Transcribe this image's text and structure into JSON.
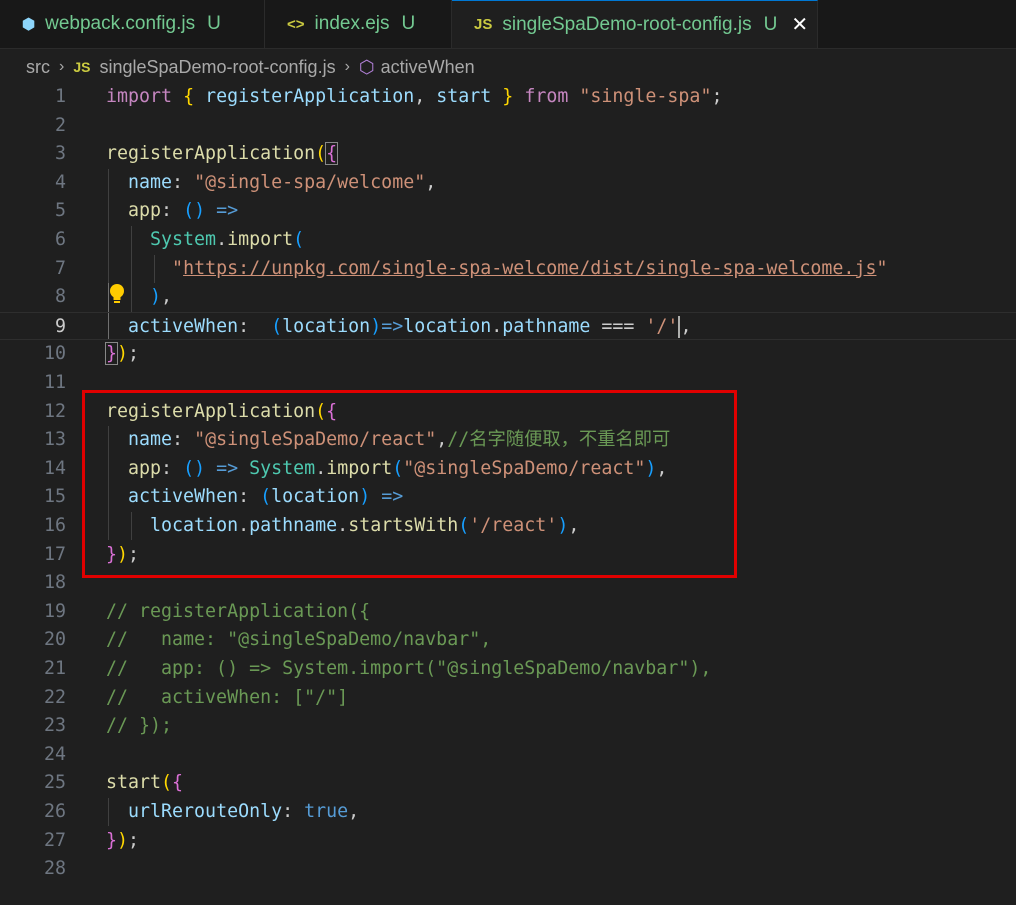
{
  "tabs": [
    {
      "icon": "webpack-icon",
      "name": "webpack.config.js",
      "status": "U"
    },
    {
      "icon": "ejs-file-icon",
      "name": "index.ejs",
      "status": "U"
    },
    {
      "icon": "js-file-icon",
      "prefix": "JS",
      "name": "singleSpaDemo-root-config.js",
      "status": "U",
      "close": "✕"
    }
  ],
  "breadcrumb": {
    "folder": "src",
    "file_prefix": "JS",
    "file": "singleSpaDemo-root-config.js",
    "symbol": "activeWhen"
  },
  "line_numbers": [
    "1",
    "2",
    "3",
    "4",
    "5",
    "6",
    "7",
    "8",
    "9",
    "10",
    "11",
    "12",
    "13",
    "14",
    "15",
    "16",
    "17",
    "18",
    "19",
    "20",
    "21",
    "22",
    "23",
    "24",
    "25",
    "26",
    "27",
    "28"
  ],
  "current_line": 9,
  "code": {
    "l1": {
      "import": "import",
      "ob": "{",
      "name1": "registerApplication",
      "comma": ",",
      "name2": "start",
      "cb": "}",
      "from": "from",
      "module": "\"single-spa\"",
      "semi": ";"
    },
    "l3": {
      "fn": "registerApplication",
      "p": "(",
      "b": "{"
    },
    "l4": {
      "key": "name",
      "colon": ":",
      "val": "\"@single-spa/welcome\"",
      "comma": ","
    },
    "l5": {
      "key": "app",
      "colon": ":",
      "paren": "()",
      "arrow": "=>"
    },
    "l6": {
      "obj": "System",
      "dot": ".",
      "fn": "import",
      "p": "("
    },
    "l7": {
      "q1": "\"",
      "url": "https://unpkg.com/single-spa-welcome/dist/single-spa-welcome.js",
      "q2": "\""
    },
    "l8": {
      "p": ")",
      "comma": ","
    },
    "l9": {
      "key": "activeWhen",
      "colon": ":",
      "po": "(",
      "param": "location",
      "pc": ")",
      "arrow": "=>",
      "obj": "location",
      "dot": ".",
      "prop": "pathname",
      "op": "===",
      "val": "'/'",
      "comma": ","
    },
    "l10": {
      "b": "}",
      "p": ")",
      "semi": ";"
    },
    "l12": {
      "fn": "registerApplication",
      "p": "(",
      "b": "{"
    },
    "l13": {
      "key": "name",
      "colon": ":",
      "val": "\"@singleSpaDemo/react\"",
      "comma": ",",
      "comment": "//名字随便取，不重名即可"
    },
    "l14": {
      "key": "app",
      "colon": ":",
      "paren": "()",
      "arrow": "=>",
      "obj": "System",
      "dot": ".",
      "fn": "import",
      "po": "(",
      "val": "\"@singleSpaDemo/react\"",
      "pc": ")",
      "comma": ","
    },
    "l15": {
      "key": "activeWhen",
      "colon": ":",
      "po": "(",
      "param": "location",
      "pc": ")",
      "arrow": "=>"
    },
    "l16": {
      "obj": "location",
      "d1": ".",
      "prop": "pathname",
      "d2": ".",
      "fn": "startsWith",
      "po": "(",
      "val": "'/react'",
      "pc": ")",
      "comma": ","
    },
    "l17": {
      "b": "}",
      "p": ")",
      "semi": ";"
    },
    "l19": "// registerApplication({",
    "l20": "//   name: \"@singleSpaDemo/navbar\",",
    "l21": "//   app: () => System.import(\"@singleSpaDemo/navbar\"),",
    "l22": "//   activeWhen: [\"/\"]",
    "l23": "// });",
    "l25": {
      "fn": "start",
      "p": "(",
      "b": "{"
    },
    "l26": {
      "key": "urlRerouteOnly",
      "colon": ":",
      "val": "true",
      "comma": ","
    },
    "l27": {
      "b": "}",
      "p": ")",
      "semi": ";"
    }
  },
  "colors": {
    "highlight_box": "#e00000",
    "keyword": "#c586c0",
    "function": "#dcdcaa",
    "string": "#ce9178",
    "comment": "#6a9955"
  }
}
